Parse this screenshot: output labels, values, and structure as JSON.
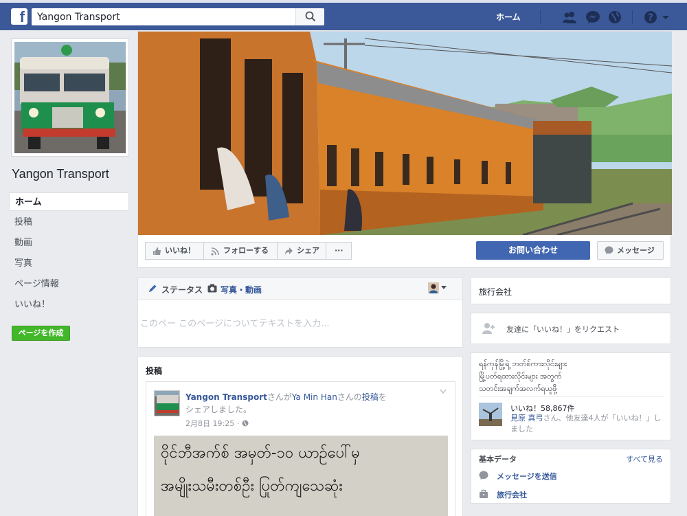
{
  "topbar": {
    "logo": "f",
    "search_value": "Yangon Transport",
    "search_placeholder": "検索",
    "home_label": "ホーム",
    "icons": [
      "friends-icon",
      "messenger-icon",
      "globe-icon",
      "help-icon",
      "caret-down-icon"
    ]
  },
  "sidebar": {
    "page_name": "Yangon Transport",
    "items": [
      {
        "label": "ホーム",
        "active": true
      },
      {
        "label": "投稿"
      },
      {
        "label": "動画"
      },
      {
        "label": "写真"
      },
      {
        "label": "ページ情報"
      },
      {
        "label": "いいね！"
      }
    ],
    "create_page": "ページを作成"
  },
  "actions": {
    "like": "いいね！",
    "follow": "フォローする",
    "share": "シェア",
    "more": "···",
    "contact": "お問い合わせ",
    "message": "メッセージ"
  },
  "composer": {
    "tab_status": "ステータス",
    "tab_photo": "写真・動画",
    "placeholder": "このペー このページについてテキストを入力..."
  },
  "posts": {
    "title": "投稿",
    "author": "Yangon Transport",
    "text_1": "さんが",
    "person": "Ya Min Han",
    "text_2": "さんの",
    "post_link": "投稿",
    "text_3": "を",
    "text_4": "シェアしました。",
    "date": "2月8日 19:25 · ",
    "image_lines": [
      "ဝိုင်ဘီအက်စ် အမှတ်-၁၀ ယာဉ်ပေါ်မှ",
      "အမျိုးသမီးတစ်ဦး ပြုတ်ကျသေဆုံး"
    ]
  },
  "right": {
    "category": "旅行会社",
    "invite": "友達に「いいね！」をリクエスト",
    "about_lines": [
      "ရန်ကုန်မြို့ရဲ့ ဘတ်စ်ကားလိုင်းများ",
      "မြို့ပတ်ရထားလိုင်းများ အတွက်",
      "သတင်းအချက်အလက်ရယူဖို့"
    ],
    "likes_count": "いいね！58,867件",
    "likes_name": "見原 真弓",
    "likes_rest": "さん、他友達4人が「いいね！」しました",
    "basic_title": "基本データ",
    "see_all": "すべて見る",
    "send_message": "メッセージを送信",
    "basic_category": "旅行会社"
  },
  "colors": {
    "brand_blue": "#3b5998",
    "button_blue": "#4267b2",
    "create_green": "#42b72a",
    "background": "#e9ebee"
  }
}
